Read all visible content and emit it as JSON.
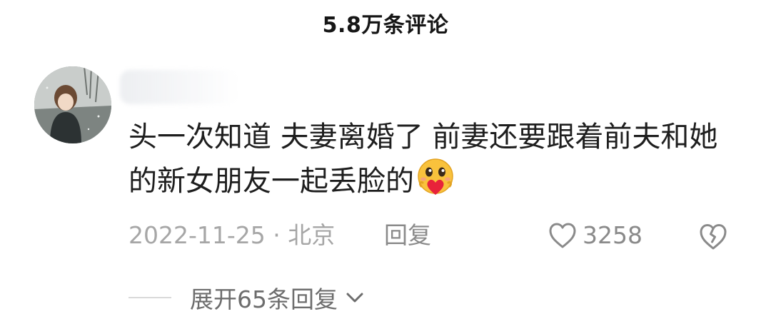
{
  "header": {
    "title": "5.8万条评论"
  },
  "comment": {
    "text": "头一次知道 夫妻离婚了 前妻还要跟着前夫和她的新女朋友一起丢脸的",
    "emoji_icon": "heart-smile-emoji-icon",
    "meta": "2022-11-25 · 北京",
    "reply_label": "回复",
    "like_count": "3258"
  },
  "replies": {
    "expand_label": "展开65条回复"
  },
  "colors": {
    "primary_text": "#1e1e1e",
    "secondary_text": "#a6a6a6",
    "action_text": "#8a8a8a",
    "emoji_face": "#f9c23c",
    "emoji_heart": "#e8233a"
  }
}
